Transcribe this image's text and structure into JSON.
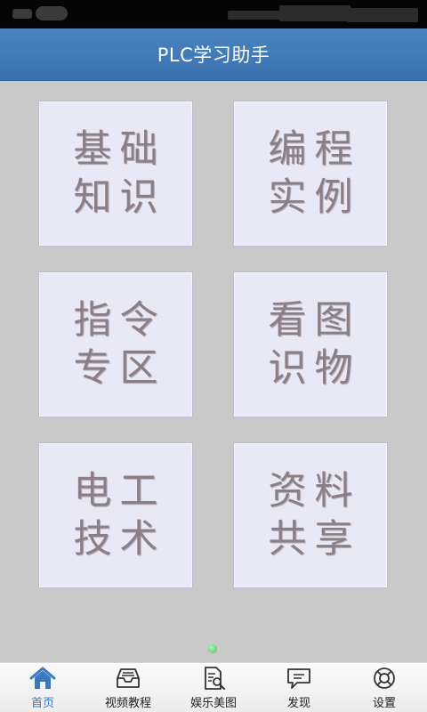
{
  "header": {
    "title": "PLC学习助手"
  },
  "tiles": [
    {
      "line1": "基础",
      "line2": "知识"
    },
    {
      "line1": "编程",
      "line2": "实例"
    },
    {
      "line1": "指令",
      "line2": "专区"
    },
    {
      "line1": "看图",
      "line2": "识物"
    },
    {
      "line1": "电工",
      "line2": "技术"
    },
    {
      "line1": "资料",
      "line2": "共享"
    }
  ],
  "tabs": [
    {
      "label": "首页",
      "icon": "home-icon",
      "active": true
    },
    {
      "label": "视频教程",
      "icon": "inbox-tray-icon"
    },
    {
      "label": "娱乐美图",
      "icon": "document-search-icon"
    },
    {
      "label": "发现",
      "icon": "chat-bubble-icon"
    },
    {
      "label": "设置",
      "icon": "lifebuoy-icon"
    }
  ],
  "colors": {
    "title_bar": "#3a72b0",
    "active_tab": "#3a78c0",
    "tile_background": "#e8e8f6",
    "tile_text": "#8a7f86",
    "page_indicator": "#3fc35a"
  }
}
